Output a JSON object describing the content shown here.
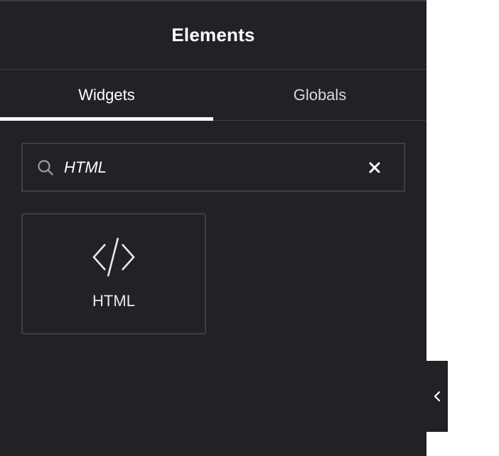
{
  "panel": {
    "title": "Elements"
  },
  "tabs": [
    {
      "label": "Widgets",
      "active": true
    },
    {
      "label": "Globals",
      "active": false
    }
  ],
  "search": {
    "value": "HTML",
    "icon": "search-icon",
    "clear_icon": "close-icon"
  },
  "widgets": [
    {
      "label": "HTML",
      "icon": "code-icon"
    }
  ],
  "collapse": {
    "icon": "chevron-left-icon"
  },
  "colors": {
    "panel_bg": "#212226",
    "border": "#3f4045",
    "text": "#ffffff",
    "canvas_bg": "#ffffff"
  }
}
